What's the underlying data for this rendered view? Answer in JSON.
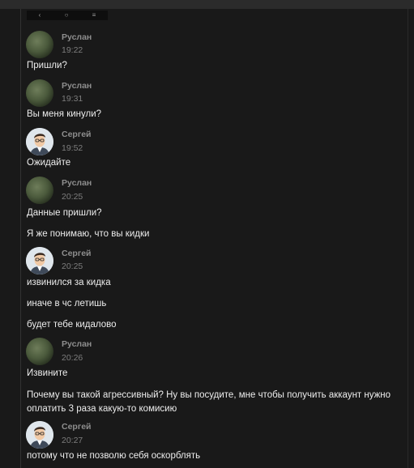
{
  "toolbar": {
    "icons": [
      "back-icon",
      "home-icon",
      "menu-icon"
    ],
    "back_glyph": "‹",
    "home_glyph": "○",
    "menu_glyph": "≡"
  },
  "authors": {
    "ruslan": "Руслан",
    "sergey": "Сергей"
  },
  "messages": [
    {
      "author": "Руслан",
      "time": "19:22",
      "texts": [
        "Пришли?"
      ]
    },
    {
      "author": "Руслан",
      "time": "19:31",
      "texts": [
        "Вы меня кинули?"
      ]
    },
    {
      "author": "Сергей",
      "time": "19:52",
      "texts": [
        "Ожидайте"
      ]
    },
    {
      "author": "Руслан",
      "time": "20:25",
      "texts": [
        "Данные пришли?",
        "Я же понимаю, что вы кидки"
      ]
    },
    {
      "author": "Сергей",
      "time": "20:25",
      "texts": [
        "извинился за кидка",
        "иначе в чс летишь",
        "будет тебе кидалово"
      ]
    },
    {
      "author": "Руслан",
      "time": "20:26",
      "texts": [
        "Извините",
        "Почему вы такой агрессивный? Ну вы посудите, мне чтобы получить аккаунт нужно оплатить 3 раза какую-то комисию"
      ]
    },
    {
      "author": "Сергей",
      "time": "20:27",
      "texts": [
        "потому что не позволю себя оскорблять"
      ]
    }
  ]
}
